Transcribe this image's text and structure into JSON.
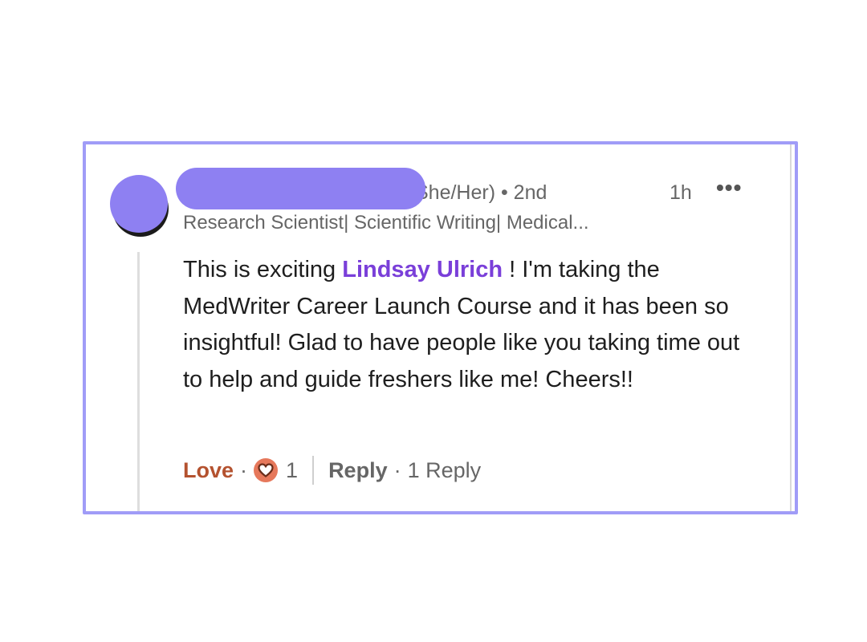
{
  "comment": {
    "pronouns_degree": "She/Her) • 2nd",
    "time": "1h",
    "more_label": "•••",
    "headline": "Research Scientist| Scientific Writing| Medical...",
    "body_before_mention": "This is exciting ",
    "mention": "Lindsay Ulrich",
    "body_after_mention": " ! I'm taking the MedWriter Career Launch Course and it has been so insightful! Glad to have people like you taking time out to help and guide freshers like me! Cheers!!",
    "reaction_label": "Love",
    "reaction_count": "1",
    "reply_label": "Reply",
    "replies_label": "1 Reply"
  },
  "colors": {
    "frame_border": "#a09cf7",
    "redaction": "#8e80f2",
    "mention": "#7a3fd9",
    "love": "#b4522f",
    "heart_badge": "#e6785b"
  },
  "icons": {
    "reaction": "heart-icon",
    "more": "more-horizontal-icon"
  }
}
